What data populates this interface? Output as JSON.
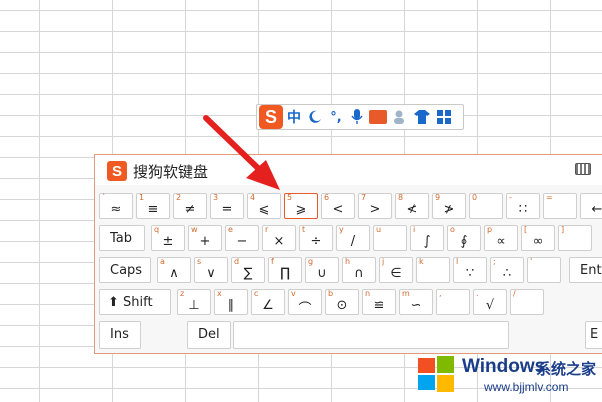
{
  "ime_toolbar": {
    "logo": "S",
    "mode": "中",
    "items": [
      "moon-icon",
      "punctuation-icon",
      "microphone-icon",
      "keyboard-icon",
      "user-icon",
      "skin-icon",
      "grid-icon"
    ],
    "punct": "°,"
  },
  "keyboard": {
    "logo": "S",
    "title": "搜狗软键盘",
    "rows": [
      [
        {
          "sub": "`",
          "sym": "≈"
        },
        {
          "sub": "1",
          "sym": "≡"
        },
        {
          "sub": "2",
          "sym": "≠"
        },
        {
          "sub": "3",
          "sym": "="
        },
        {
          "sub": "4",
          "sym": "⩽"
        },
        {
          "sub": "5",
          "sym": "⩾"
        },
        {
          "sub": "6",
          "sym": "<"
        },
        {
          "sub": "7",
          "sym": ">"
        },
        {
          "sub": "8",
          "sym": "≮"
        },
        {
          "sub": "9",
          "sym": "≯"
        },
        {
          "sub": "0",
          "sym": ""
        },
        {
          "sub": "-",
          "sym": "∷"
        },
        {
          "sub": "=",
          "sym": ""
        },
        {
          "sub": "",
          "sym": "←"
        }
      ],
      [
        {
          "sub": "q",
          "sym": "±"
        },
        {
          "sub": "w",
          "sym": "+"
        },
        {
          "sub": "e",
          "sym": "−"
        },
        {
          "sub": "r",
          "sym": "×"
        },
        {
          "sub": "t",
          "sym": "÷"
        },
        {
          "sub": "y",
          "sym": "/"
        },
        {
          "sub": "u",
          "sym": ""
        },
        {
          "sub": "i",
          "sym": "∫"
        },
        {
          "sub": "o",
          "sym": "∮"
        },
        {
          "sub": "p",
          "sym": "∝"
        },
        {
          "sub": "[",
          "sym": "∞"
        },
        {
          "sub": "]",
          "sym": ""
        }
      ],
      [
        {
          "sub": "a",
          "sym": "∧"
        },
        {
          "sub": "s",
          "sym": "∨"
        },
        {
          "sub": "d",
          "sym": "∑"
        },
        {
          "sub": "f",
          "sym": "∏"
        },
        {
          "sub": "g",
          "sym": "∪"
        },
        {
          "sub": "h",
          "sym": "∩"
        },
        {
          "sub": "j",
          "sym": "∈"
        },
        {
          "sub": "k",
          "sym": ""
        },
        {
          "sub": "l",
          "sym": "∵"
        },
        {
          "sub": ";",
          "sym": "∴"
        },
        {
          "sub": "'",
          "sym": ""
        }
      ],
      [
        {
          "sub": "z",
          "sym": "⊥"
        },
        {
          "sub": "x",
          "sym": "∥"
        },
        {
          "sub": "c",
          "sym": "∠"
        },
        {
          "sub": "v",
          "sym": "⌒"
        },
        {
          "sub": "b",
          "sym": "⊙"
        },
        {
          "sub": "n",
          "sym": "≌"
        },
        {
          "sub": "m",
          "sym": "∽"
        },
        {
          "sub": ",",
          "sym": ""
        },
        {
          "sub": ".",
          "sym": "√"
        },
        {
          "sub": "/",
          "sym": ""
        }
      ]
    ],
    "labels": {
      "tab": "Tab",
      "caps": "Caps",
      "shift": "⬆ Shift",
      "enter": "Ent",
      "ins": "Ins",
      "del": "Del",
      "right": "E"
    }
  },
  "watermark": {
    "brand": "Windows",
    "suffix": "系统之家",
    "url": "www.bjjmlv.com"
  }
}
